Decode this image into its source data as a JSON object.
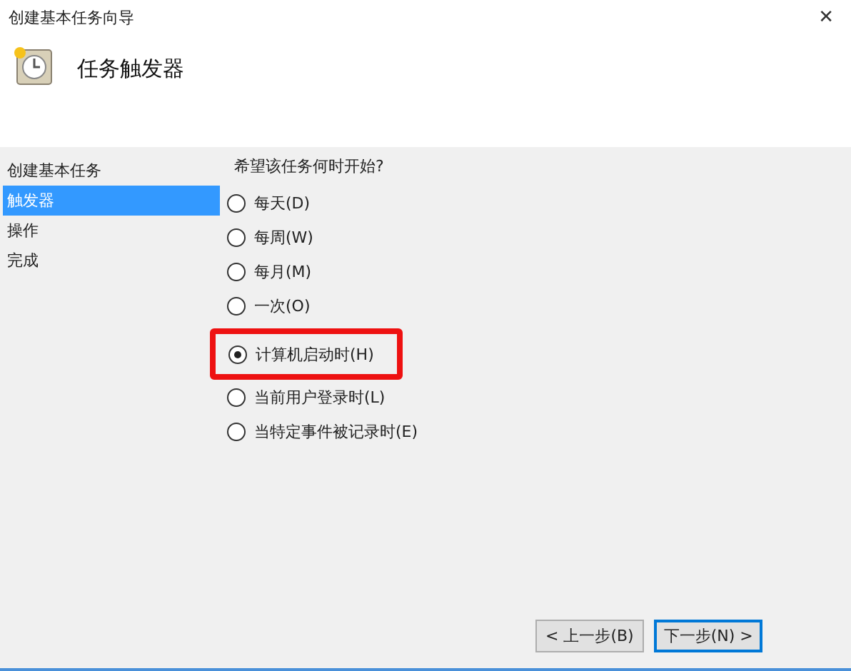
{
  "window": {
    "title": "创建基本任务向导",
    "close": "✕"
  },
  "header": {
    "title": "任务触发器"
  },
  "sidebar": {
    "items": [
      {
        "label": "创建基本任务",
        "selected": false
      },
      {
        "label": "触发器",
        "selected": true
      },
      {
        "label": "操作",
        "selected": false
      },
      {
        "label": "完成",
        "selected": false
      }
    ]
  },
  "question": "希望该任务何时开始?",
  "options": [
    {
      "label": "每天(D)",
      "selected": false,
      "highlighted": false
    },
    {
      "label": "每周(W)",
      "selected": false,
      "highlighted": false
    },
    {
      "label": "每月(M)",
      "selected": false,
      "highlighted": false
    },
    {
      "label": "一次(O)",
      "selected": false,
      "highlighted": false
    },
    {
      "label": "计算机启动时(H)",
      "selected": true,
      "highlighted": true
    },
    {
      "label": "当前用户登录时(L)",
      "selected": false,
      "highlighted": false
    },
    {
      "label": "当特定事件被记录时(E)",
      "selected": false,
      "highlighted": false
    }
  ],
  "buttons": [
    {
      "label": "< 上一步(B)",
      "default": false
    },
    {
      "label": "下一步(N) >",
      "default": true
    }
  ]
}
